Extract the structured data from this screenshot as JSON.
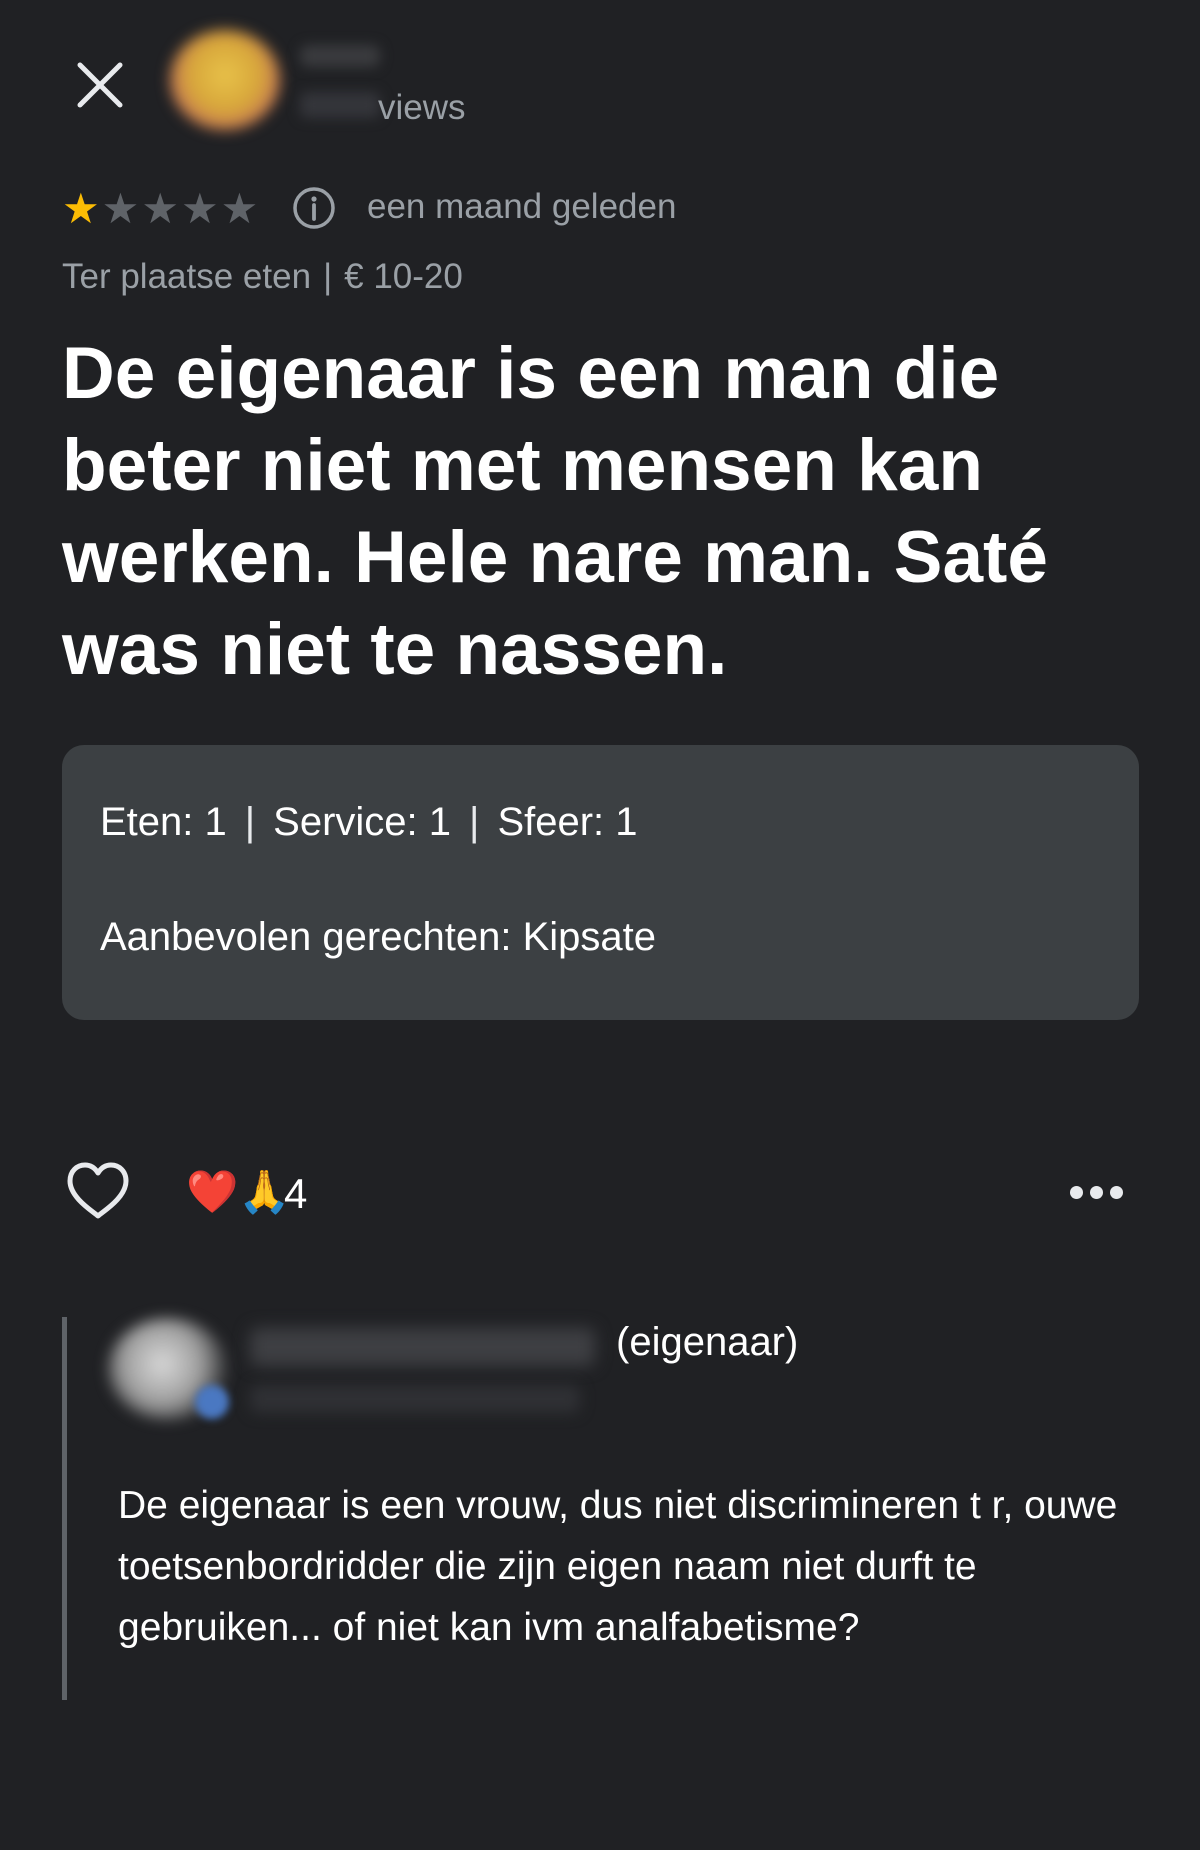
{
  "header": {
    "close_icon": "close-icon",
    "reviews_label": "views"
  },
  "review": {
    "rating": 1,
    "max_rating": 5,
    "star_filled_color": "#fbbc04",
    "star_empty_color": "#5f6368",
    "time_ago": "een maand geleden",
    "service_type": "Ter plaatse eten",
    "meta_separator": "|",
    "price_range": "€ 10-20",
    "text": "De eigenaar is een man die beter niet met mensen kan werken. Hele nare man. Saté was niet te nassen."
  },
  "ratings_card": {
    "food_label": "Eten:",
    "food_value": "1",
    "service_label": "Service:",
    "service_value": "1",
    "atmosphere_label": "Sfeer:",
    "atmosphere_value": "1",
    "separator": "|",
    "recommended_label": "Aanbevolen gerechten:",
    "recommended_value": "Kipsate"
  },
  "reactions": {
    "emojis": "❤️🙏",
    "count": "4"
  },
  "owner_reply": {
    "role_suffix": "(eigenaar)",
    "text": "De eigenaar is een vrouw, dus niet discrimineren t r, ouwe toetsenbordridder die zijn eigen naam niet durft te gebruiken... of niet kan ivm analfabetisme?"
  },
  "colors": {
    "background": "#202124",
    "card": "#3c4043",
    "muted_text": "#9aa0a6"
  }
}
